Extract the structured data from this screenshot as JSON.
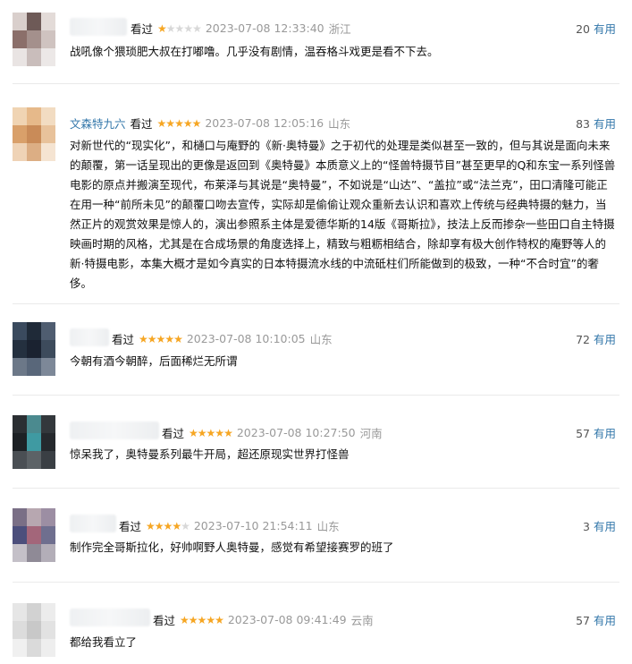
{
  "useful_label": "有用",
  "star_color": "#f6a623",
  "reviews": [
    {
      "name": "",
      "seen": "看过",
      "stars": 1,
      "time": "2023-07-08 12:33:40",
      "location": "浙江",
      "votes": "20",
      "content": "战吼像个猥琐肥大叔在打嘟噜。几乎没有剧情，温吞格斗戏更是看不下去。"
    },
    {
      "name": "文森特九六",
      "seen": "看过",
      "stars": 5,
      "time": "2023-07-08 12:05:16",
      "location": "山东",
      "votes": "83",
      "content": "对新世代的“现实化”，和樋口与庵野的《新·奥特曼》之于初代的处理是类似甚至一致的，但与其说是面向未来的颠覆，第一话呈现出的更像是返回到《奥特曼》本质意义上的“怪兽特摄节目”甚至更早的Q和东宝一系列怪兽电影的原点并搬演至现代，布莱泽与其说是“奥特曼”，不如说是“山达”、“盖拉”或“法兰克”，田口清隆可能正在用一种“前所未见”的颠覆口吻去宣传，实际却是偷偷让观众重新去认识和喜欢上传统与经典特摄的魅力，当然正片的观赏效果是惊人的，演出参照系主体是爱德华斯的14版《哥斯拉》，技法上反而掺杂一些田口自主特摄映画时期的风格，尤其是在合成场景的角度选择上，精致与粗粝相结合，除却享有极大创作特权的庵野等人的新·特摄电影，本集大概才是如今真实的日本特摄流水线的中流砥柱们所能做到的极致，一种“不合时宜”的奢侈。"
    },
    {
      "name": "",
      "seen": "看过",
      "stars": 5,
      "time": "2023-07-08 10:10:05",
      "location": "山东",
      "votes": "72",
      "content": "今朝有酒今朝醉，后面稀烂无所谓"
    },
    {
      "name": "",
      "seen": "看过",
      "stars": 5,
      "time": "2023-07-08 10:27:50",
      "location": "河南",
      "votes": "57",
      "content": "惊呆我了，奥特曼系列最牛开局，超还原现实世界打怪兽"
    },
    {
      "name": "",
      "seen": "看过",
      "stars": 4,
      "time": "2023-07-10 21:54:11",
      "location": "山东",
      "votes": "3",
      "content": "制作完全哥斯拉化，好帅啊野人奥特曼，感觉有希望接赛罗的班了"
    },
    {
      "name": "",
      "seen": "看过",
      "stars": 5,
      "time": "2023-07-08 09:41:49",
      "location": "云南",
      "votes": "57",
      "content": "都给我看立了"
    }
  ]
}
